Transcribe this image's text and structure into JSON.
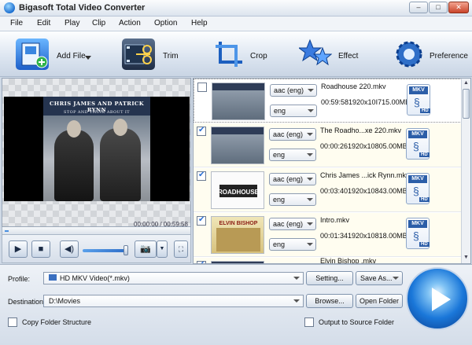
{
  "window": {
    "title": "Bigasoft Total Video Converter",
    "minimize": "–",
    "maximize": "□",
    "close": "✕"
  },
  "menu": [
    "File",
    "Edit",
    "Play",
    "Clip",
    "Action",
    "Option",
    "Help"
  ],
  "toolbar": {
    "add_file": "Add File",
    "trim": "Trim",
    "crop": "Crop",
    "effect": "Effect",
    "preference": "Preference"
  },
  "preview": {
    "poster_title": "CHRIS JAMES AND PATRICK RYNN",
    "poster_subtitle": "STOP AND THINK ABOUT IT",
    "time": "00:00:00 / 00:59:58",
    "seek_progress": 0.02
  },
  "files": [
    {
      "checked": false,
      "audio": "aac (eng)",
      "subtitle": "eng",
      "name": "Roadhouse 220.mkv",
      "info": "00:59:581920x10I715.00ME",
      "format": "MKV",
      "hd": "HD",
      "thumb": "poster"
    },
    {
      "checked": true,
      "audio": "aac (eng)",
      "subtitle": "eng",
      "name": "The Roadho...xe 220.mkv",
      "info": "00:00:261920x10805.00MB",
      "format": "MKV",
      "hd": "HD",
      "thumb": "poster"
    },
    {
      "checked": true,
      "audio": "aac (eng)",
      "subtitle": "eng",
      "name": "Chris James ...ick Rynn.mkv",
      "info": "00:03:401920x10843.00MB",
      "format": "MKV",
      "hd": "HD",
      "thumb": "white"
    },
    {
      "checked": true,
      "audio": "aac (eng)",
      "subtitle": "eng",
      "name": "Intro.mkv",
      "info": "00:01:341920x10818.00MB",
      "format": "MKV",
      "hd": "HD",
      "thumb": "yellow"
    },
    {
      "checked": true,
      "audio": "",
      "subtitle": "",
      "name": "Elvin Bishop .mkv",
      "info": "",
      "format": "",
      "hd": "",
      "thumb": "poster"
    }
  ],
  "thumb_text": {
    "roadhouse": "ROADHOUSE",
    "elvin": "ELVIN BISHOP"
  },
  "bottom": {
    "profile_label": "Profile:",
    "profile_value": "HD MKV Video(*.mkv)",
    "settings": "Setting...",
    "save_as": "Save As...",
    "destination_label": "Destination:",
    "destination_value": "D:\\Movies",
    "browse": "Browse...",
    "open_folder": "Open Folder",
    "copy_folder": "Copy Folder Structure",
    "output_source": "Output to Source Folder"
  },
  "colors": {
    "accent": "#1a77d9",
    "selected_row": "#fffdf0",
    "toolbar_bg": "#dde6f1"
  }
}
